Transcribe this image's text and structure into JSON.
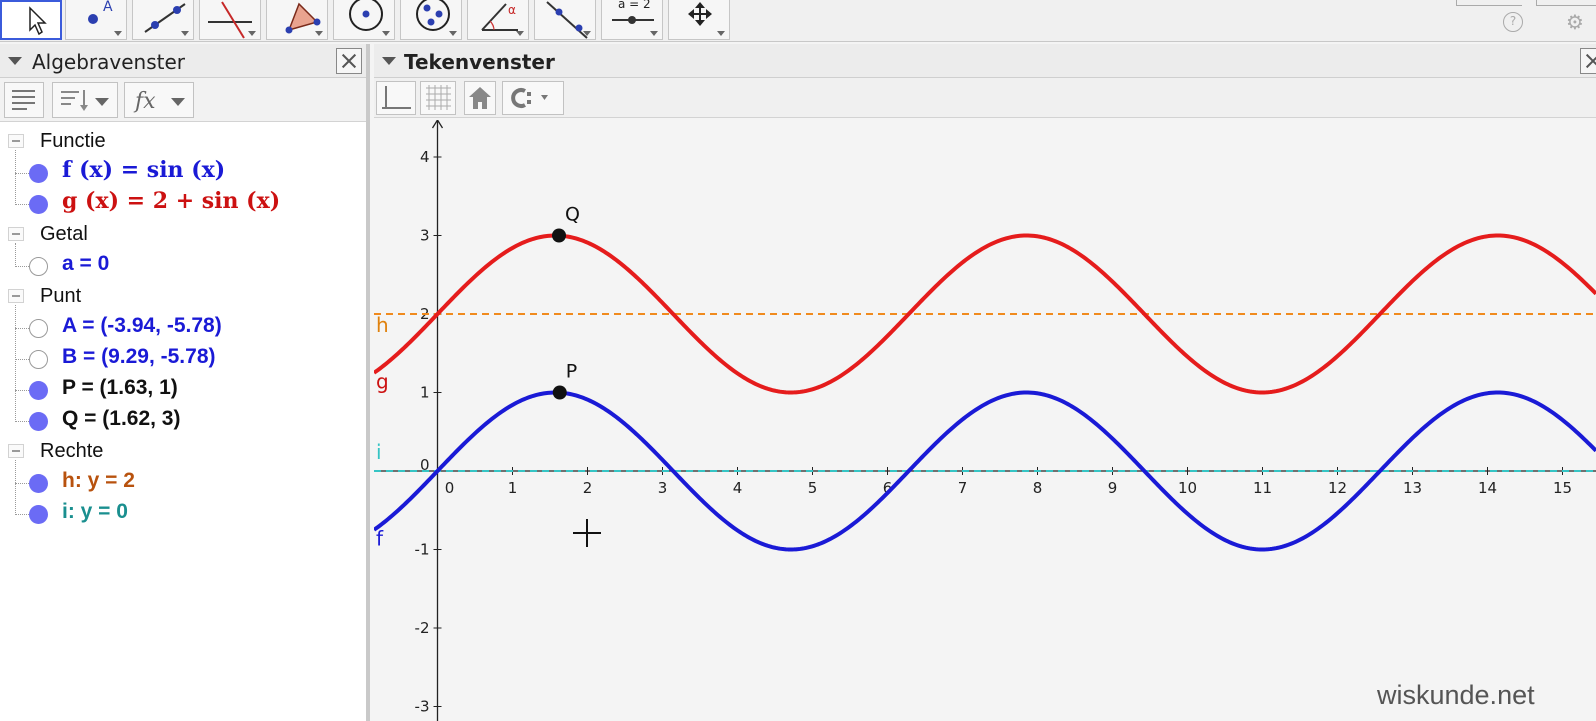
{
  "algebra": {
    "title": "Algebravenster",
    "categories": [
      {
        "label": "Functie",
        "items": [
          {
            "text": "f (x) = sin (x)",
            "color": "#1a1ad6",
            "visible": true,
            "math": true
          },
          {
            "text": "g (x) = 2 + sin (x)",
            "color": "#cc1111",
            "visible": true,
            "math": true
          }
        ]
      },
      {
        "label": "Getal",
        "items": [
          {
            "text": "a = 0",
            "color": "#1a1ad6",
            "visible": false,
            "math": false
          }
        ]
      },
      {
        "label": "Punt",
        "items": [
          {
            "text": "A = (-3.94, -5.78)",
            "color": "#1a1ad6",
            "visible": false,
            "math": false
          },
          {
            "text": "B = (9.29, -5.78)",
            "color": "#1a1ad6",
            "visible": false,
            "math": false
          },
          {
            "text": "P = (1.63, 1)",
            "color": "#111111",
            "visible": true,
            "math": false
          },
          {
            "text": "Q = (1.62, 3)",
            "color": "#111111",
            "visible": true,
            "math": false
          }
        ]
      },
      {
        "label": "Rechte",
        "items": [
          {
            "text": "h: y = 2",
            "color": "#b8520e",
            "visible": true,
            "math": false
          },
          {
            "text": "i: y = 0",
            "color": "#1a8f8f",
            "visible": true,
            "math": false
          }
        ]
      }
    ]
  },
  "graphics": {
    "title": "Tekenvenster"
  },
  "toolbar": {
    "tools": [
      "move-tool",
      "point-tool",
      "line-tool",
      "perpendicular-tool",
      "polygon-tool",
      "circle-tool",
      "conic-tool",
      "angle-tool",
      "reflect-tool",
      "slider-tool",
      "move-view-tool"
    ],
    "slider_label": "a = 2",
    "point_label": "A",
    "angle_label": "α",
    "help_label": "?"
  },
  "watermark": "wiskunde.net",
  "chart_data": {
    "type": "line",
    "xlim": [
      -0.9,
      15.1
    ],
    "ylim": [
      -3,
      4.5
    ],
    "x_ticks": [
      "0",
      "1",
      "2",
      "3",
      "4",
      "5",
      "6",
      "7",
      "8",
      "9",
      "10",
      "11",
      "12",
      "13",
      "14",
      "15"
    ],
    "y_ticks": [
      "-3",
      "-2",
      "-1",
      "0",
      "1",
      "2",
      "3",
      "4"
    ],
    "grid": false,
    "series": [
      {
        "name": "f",
        "expr": "sin(x)",
        "color": "#1a1ad6",
        "style": "solid",
        "label_color": "#1a1ad6"
      },
      {
        "name": "g",
        "expr": "2+sin(x)",
        "color": "#e51c1c",
        "style": "solid",
        "label_color": "#cc1111"
      }
    ],
    "lines": [
      {
        "name": "h",
        "y": 2,
        "color": "#f08a1d",
        "style": "dashed",
        "label_color": "#e0820e"
      },
      {
        "name": "i",
        "y": 0,
        "color": "#35c4c4",
        "style": "dashed",
        "label_color": "#35c4c4"
      }
    ],
    "points": [
      {
        "name": "P",
        "x": 1.63,
        "y": 1
      },
      {
        "name": "Q",
        "x": 1.62,
        "y": 3
      }
    ]
  }
}
